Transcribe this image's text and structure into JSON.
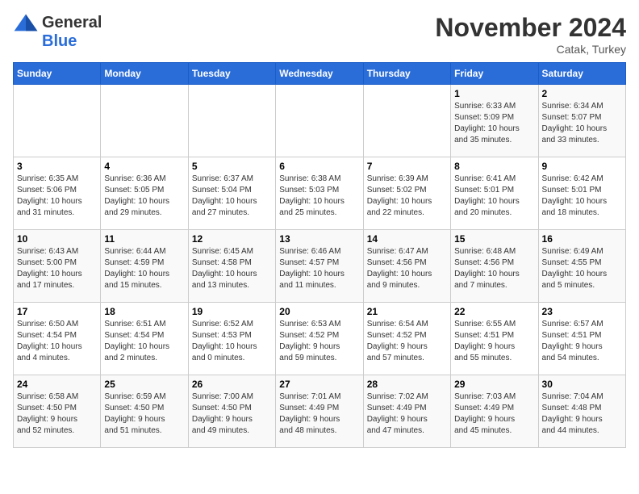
{
  "logo": {
    "general": "General",
    "blue": "Blue"
  },
  "header": {
    "month": "November 2024",
    "location": "Catak, Turkey"
  },
  "weekdays": [
    "Sunday",
    "Monday",
    "Tuesday",
    "Wednesday",
    "Thursday",
    "Friday",
    "Saturday"
  ],
  "weeks": [
    [
      {
        "day": "",
        "info": ""
      },
      {
        "day": "",
        "info": ""
      },
      {
        "day": "",
        "info": ""
      },
      {
        "day": "",
        "info": ""
      },
      {
        "day": "",
        "info": ""
      },
      {
        "day": "1",
        "info": "Sunrise: 6:33 AM\nSunset: 5:09 PM\nDaylight: 10 hours\nand 35 minutes."
      },
      {
        "day": "2",
        "info": "Sunrise: 6:34 AM\nSunset: 5:07 PM\nDaylight: 10 hours\nand 33 minutes."
      }
    ],
    [
      {
        "day": "3",
        "info": "Sunrise: 6:35 AM\nSunset: 5:06 PM\nDaylight: 10 hours\nand 31 minutes."
      },
      {
        "day": "4",
        "info": "Sunrise: 6:36 AM\nSunset: 5:05 PM\nDaylight: 10 hours\nand 29 minutes."
      },
      {
        "day": "5",
        "info": "Sunrise: 6:37 AM\nSunset: 5:04 PM\nDaylight: 10 hours\nand 27 minutes."
      },
      {
        "day": "6",
        "info": "Sunrise: 6:38 AM\nSunset: 5:03 PM\nDaylight: 10 hours\nand 25 minutes."
      },
      {
        "day": "7",
        "info": "Sunrise: 6:39 AM\nSunset: 5:02 PM\nDaylight: 10 hours\nand 22 minutes."
      },
      {
        "day": "8",
        "info": "Sunrise: 6:41 AM\nSunset: 5:01 PM\nDaylight: 10 hours\nand 20 minutes."
      },
      {
        "day": "9",
        "info": "Sunrise: 6:42 AM\nSunset: 5:01 PM\nDaylight: 10 hours\nand 18 minutes."
      }
    ],
    [
      {
        "day": "10",
        "info": "Sunrise: 6:43 AM\nSunset: 5:00 PM\nDaylight: 10 hours\nand 17 minutes."
      },
      {
        "day": "11",
        "info": "Sunrise: 6:44 AM\nSunset: 4:59 PM\nDaylight: 10 hours\nand 15 minutes."
      },
      {
        "day": "12",
        "info": "Sunrise: 6:45 AM\nSunset: 4:58 PM\nDaylight: 10 hours\nand 13 minutes."
      },
      {
        "day": "13",
        "info": "Sunrise: 6:46 AM\nSunset: 4:57 PM\nDaylight: 10 hours\nand 11 minutes."
      },
      {
        "day": "14",
        "info": "Sunrise: 6:47 AM\nSunset: 4:56 PM\nDaylight: 10 hours\nand 9 minutes."
      },
      {
        "day": "15",
        "info": "Sunrise: 6:48 AM\nSunset: 4:56 PM\nDaylight: 10 hours\nand 7 minutes."
      },
      {
        "day": "16",
        "info": "Sunrise: 6:49 AM\nSunset: 4:55 PM\nDaylight: 10 hours\nand 5 minutes."
      }
    ],
    [
      {
        "day": "17",
        "info": "Sunrise: 6:50 AM\nSunset: 4:54 PM\nDaylight: 10 hours\nand 4 minutes."
      },
      {
        "day": "18",
        "info": "Sunrise: 6:51 AM\nSunset: 4:54 PM\nDaylight: 10 hours\nand 2 minutes."
      },
      {
        "day": "19",
        "info": "Sunrise: 6:52 AM\nSunset: 4:53 PM\nDaylight: 10 hours\nand 0 minutes."
      },
      {
        "day": "20",
        "info": "Sunrise: 6:53 AM\nSunset: 4:52 PM\nDaylight: 9 hours\nand 59 minutes."
      },
      {
        "day": "21",
        "info": "Sunrise: 6:54 AM\nSunset: 4:52 PM\nDaylight: 9 hours\nand 57 minutes."
      },
      {
        "day": "22",
        "info": "Sunrise: 6:55 AM\nSunset: 4:51 PM\nDaylight: 9 hours\nand 55 minutes."
      },
      {
        "day": "23",
        "info": "Sunrise: 6:57 AM\nSunset: 4:51 PM\nDaylight: 9 hours\nand 54 minutes."
      }
    ],
    [
      {
        "day": "24",
        "info": "Sunrise: 6:58 AM\nSunset: 4:50 PM\nDaylight: 9 hours\nand 52 minutes."
      },
      {
        "day": "25",
        "info": "Sunrise: 6:59 AM\nSunset: 4:50 PM\nDaylight: 9 hours\nand 51 minutes."
      },
      {
        "day": "26",
        "info": "Sunrise: 7:00 AM\nSunset: 4:50 PM\nDaylight: 9 hours\nand 49 minutes."
      },
      {
        "day": "27",
        "info": "Sunrise: 7:01 AM\nSunset: 4:49 PM\nDaylight: 9 hours\nand 48 minutes."
      },
      {
        "day": "28",
        "info": "Sunrise: 7:02 AM\nSunset: 4:49 PM\nDaylight: 9 hours\nand 47 minutes."
      },
      {
        "day": "29",
        "info": "Sunrise: 7:03 AM\nSunset: 4:49 PM\nDaylight: 9 hours\nand 45 minutes."
      },
      {
        "day": "30",
        "info": "Sunrise: 7:04 AM\nSunset: 4:48 PM\nDaylight: 9 hours\nand 44 minutes."
      }
    ]
  ]
}
